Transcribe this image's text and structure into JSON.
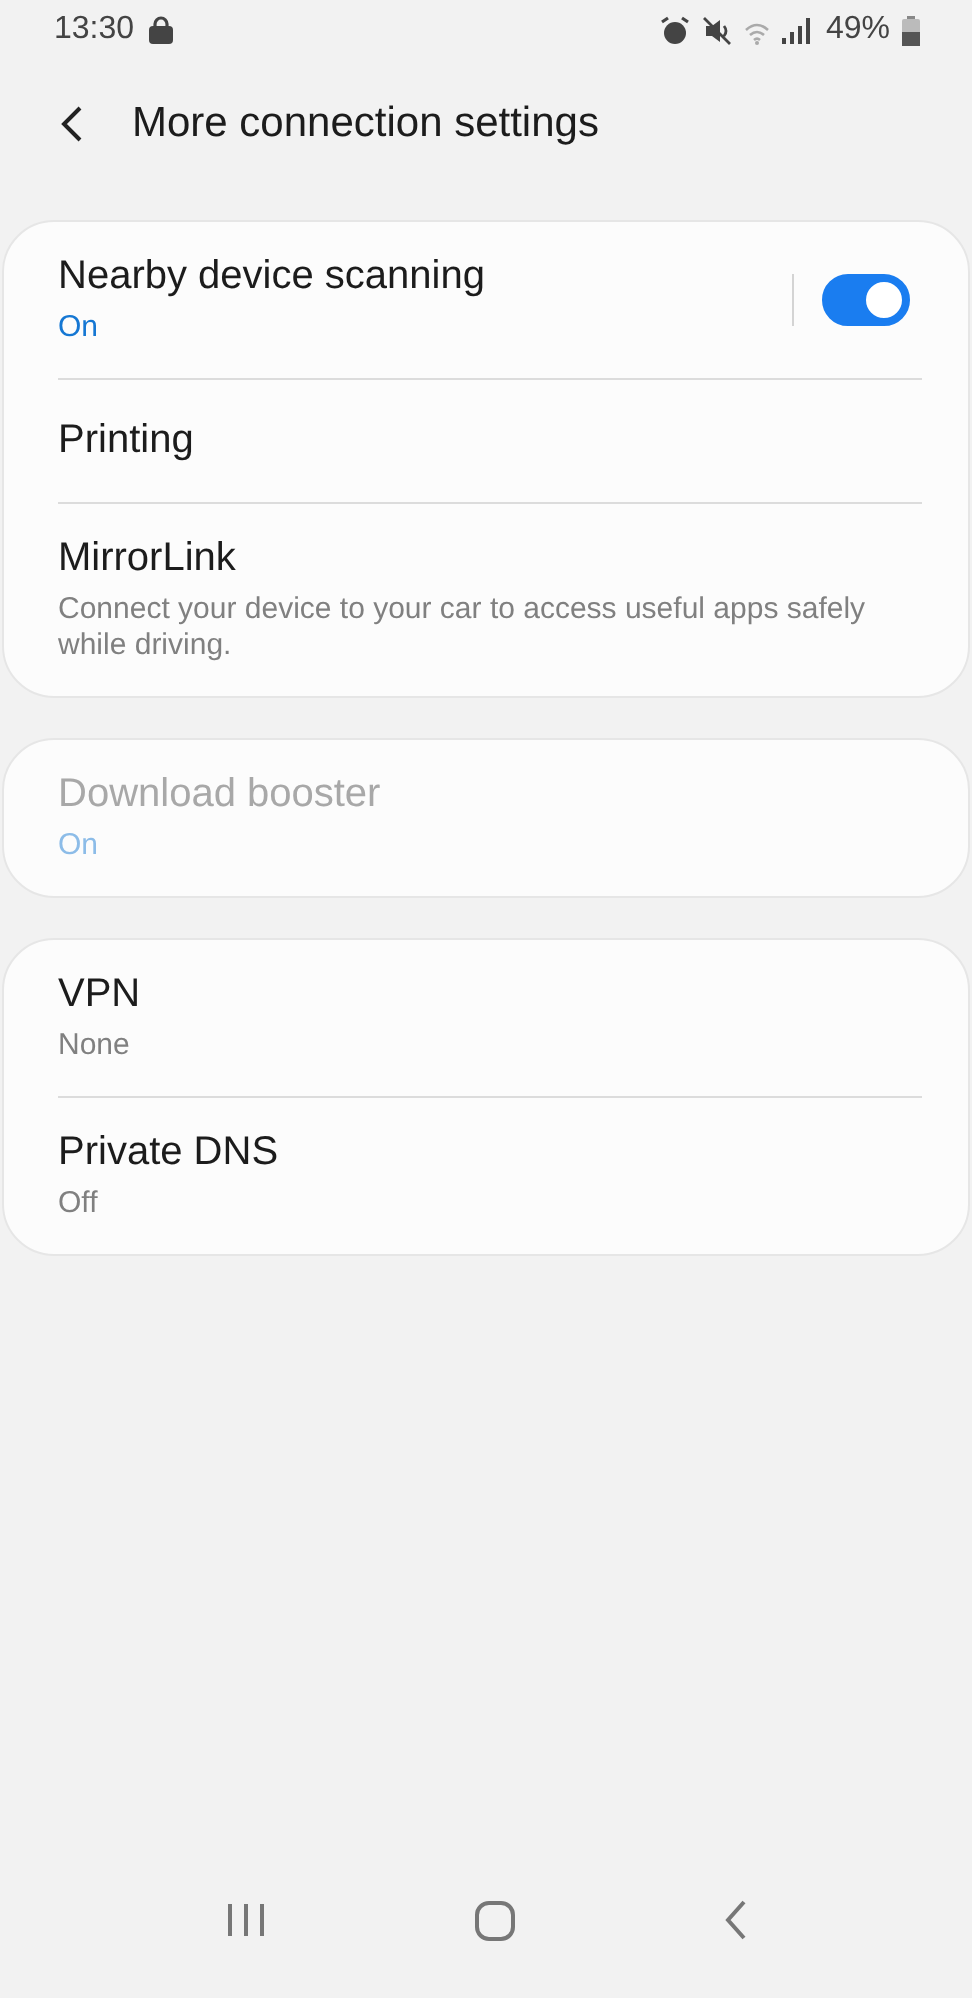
{
  "status_bar": {
    "time": "13:30",
    "battery": "49%"
  },
  "header": {
    "title": "More connection settings"
  },
  "groups": [
    {
      "items": [
        {
          "kind": "toggle",
          "title": "Nearby device scanning",
          "summary": "On",
          "accent": true,
          "disabled": false,
          "on": true
        },
        {
          "kind": "plain",
          "title": "Printing",
          "disabled": false
        },
        {
          "kind": "plain",
          "title": "MirrorLink",
          "summary": "Connect your device to your car to access useful apps safely while driving.",
          "accent": false,
          "disabled": false
        }
      ]
    },
    {
      "items": [
        {
          "kind": "plain",
          "title": "Download booster",
          "summary": "On",
          "accent": true,
          "disabled": true
        }
      ]
    },
    {
      "items": [
        {
          "kind": "plain",
          "title": "VPN",
          "summary": "None",
          "accent": false,
          "disabled": false
        },
        {
          "kind": "plain",
          "title": "Private DNS",
          "summary": "Off",
          "accent": false,
          "disabled": false
        }
      ]
    }
  ]
}
